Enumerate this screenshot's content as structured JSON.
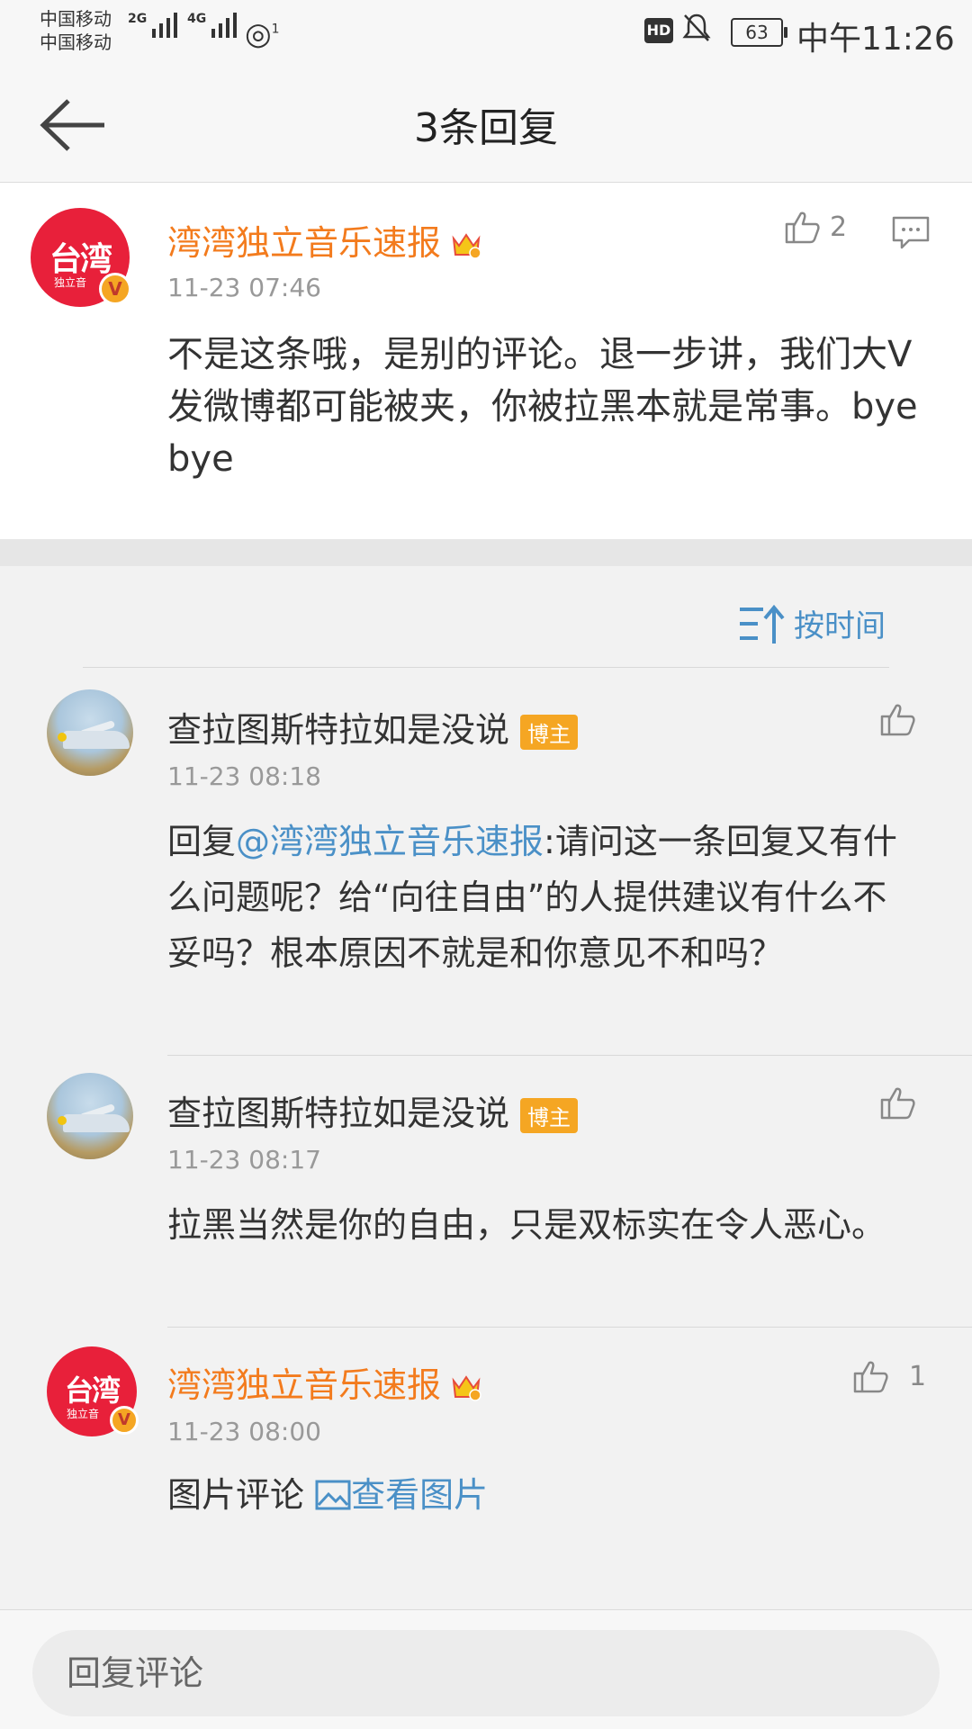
{
  "status_bar": {
    "carrier1": "中国移动",
    "carrier2": "中国移动",
    "net1": "2G",
    "net2": "4G",
    "hotspot_count": "1",
    "hd": "HD",
    "battery": "63",
    "time": "中午11:26"
  },
  "nav": {
    "title": "3条回复",
    "back_icon": "back-arrow-icon"
  },
  "root_comment": {
    "user": "湾湾独立音乐速报",
    "avatar_text": "台湾",
    "avatar_sub": "独立音",
    "verified": "V",
    "time": "11-23 07:46",
    "likes": "2",
    "content": "不是这条哦，是别的评论。退一步讲，我们大V发微博都可能被夹，你被拉黑本就是常事。bye bye"
  },
  "sort": {
    "label": "按时间"
  },
  "replies": [
    {
      "user": "查拉图斯特拉如是没说",
      "badge": "博主",
      "time": "11-23 08:18",
      "prefix": "回复",
      "mention": "@湾湾独立音乐速报",
      "content": ":请问这一条回复又有什么问题呢？给“向往自由”的人提供建议有什么不妥吗？根本原因不就是和你意见不和吗？"
    },
    {
      "user": "查拉图斯特拉如是没说",
      "badge": "博主",
      "time": "11-23 08:17",
      "content": "拉黑当然是你的自由，只是双标实在令人恶心。"
    },
    {
      "user": "湾湾独立音乐速报",
      "avatar_text": "台湾",
      "avatar_sub": "独立音",
      "verified": "V",
      "time": "11-23 08:00",
      "likes": "1",
      "content": "图片评论",
      "link": "查看图片"
    }
  ],
  "bottom": {
    "placeholder": "回复评论"
  },
  "colors": {
    "accent_orange": "#f37b1d",
    "link_blue": "#4a90c7",
    "badge_orange": "#f5a623"
  }
}
